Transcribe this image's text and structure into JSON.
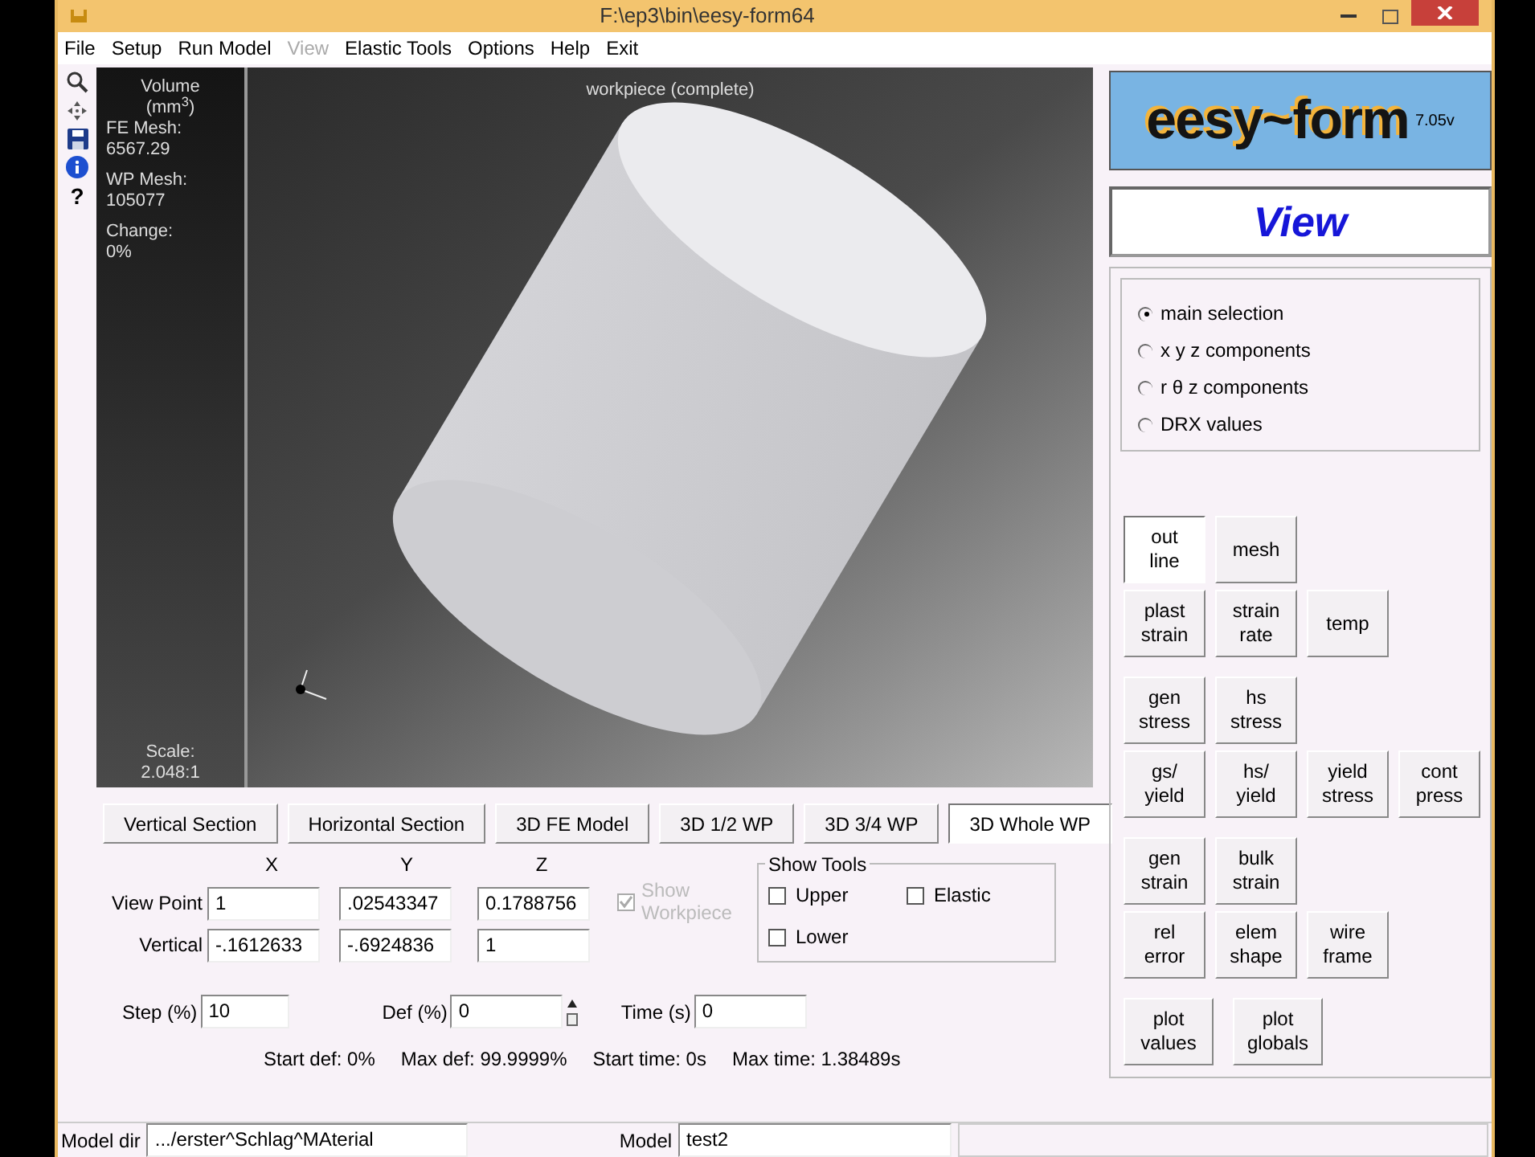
{
  "window": {
    "title": "F:\\ep3\\bin\\eesy-form64"
  },
  "menu": [
    {
      "label": "File",
      "disabled": false
    },
    {
      "label": "Setup",
      "disabled": false
    },
    {
      "label": "Run Model",
      "disabled": false
    },
    {
      "label": "View",
      "disabled": true
    },
    {
      "label": "Elastic Tools",
      "disabled": false
    },
    {
      "label": "Options",
      "disabled": false
    },
    {
      "label": "Help",
      "disabled": false
    },
    {
      "label": "Exit",
      "disabled": false
    }
  ],
  "toolbar": [
    {
      "kind": "zoom"
    },
    {
      "kind": "pan"
    },
    {
      "kind": "save"
    },
    {
      "kind": "info"
    },
    {
      "kind": "text",
      "label": "?"
    }
  ],
  "viewport": {
    "title": "workpiece (complete)",
    "info": [
      {
        "label": "Volume"
      },
      {
        "label": "(mm$^{3}$)"
      },
      {
        "label": "FE Mesh:"
      },
      {
        "label": "6567.29"
      },
      {
        "label": "WP Mesh:"
      },
      {
        "label": "105077"
      },
      {
        "label": "Change:"
      },
      {
        "label": "0%"
      }
    ],
    "scale_label": "Scale:",
    "scale": "2.048:1"
  },
  "view_buttons": [
    {
      "label": "Vertical Section",
      "selected": false
    },
    {
      "label": "Horizontal Section",
      "selected": false
    },
    {
      "label": "3D FE Model",
      "selected": false
    },
    {
      "label": "3D 1/2 WP",
      "selected": false
    },
    {
      "label": "3D 3/4 WP",
      "selected": false
    },
    {
      "label": "3D Whole WP",
      "selected": true
    }
  ],
  "coords": {
    "columns": [
      "X",
      "Y",
      "Z"
    ],
    "rows": [
      {
        "label": "View Point",
        "values": [
          "1",
          ".02543347",
          "0.1788756"
        ]
      },
      {
        "label": "Vertical",
        "values": [
          "-.1612633",
          "-.6924836",
          "1"
        ]
      }
    ]
  },
  "show_workpiece": {
    "label": "Show Workpiece",
    "checked": true,
    "disabled": true
  },
  "show_tools": {
    "title": "Show Tools",
    "items": [
      {
        "label": "Upper",
        "checked": false
      },
      {
        "label": "Elastic",
        "checked": false
      },
      {
        "label": "Lower",
        "checked": false
      }
    ]
  },
  "step": {
    "label": "Step (%)",
    "value": "10"
  },
  "def": {
    "label": "Def (%)",
    "value": "0"
  },
  "time": {
    "label": "Time (s)",
    "value": "0"
  },
  "info_line": [
    "Start def: 0%",
    "Max def: 99.9999%",
    "Start time: 0s",
    "Max time: 1.38489s"
  ],
  "logo": {
    "name": "eesy~form",
    "version": "7.05v"
  },
  "mode_title": "View",
  "radios": [
    {
      "label": "main selection",
      "selected": true
    },
    {
      "label": "x y z components",
      "selected": false
    },
    {
      "label": "r θ z components",
      "selected": false
    },
    {
      "label": "DRX values",
      "selected": false
    }
  ],
  "result_groups": [
    [
      [
        {
          "label": "out\nline",
          "selected": true
        },
        {
          "label": "mesh",
          "selected": false
        }
      ],
      [
        {
          "label": "plast\nstrain",
          "selected": false
        },
        {
          "label": "strain\nrate",
          "selected": false
        },
        {
          "label": "temp",
          "selected": false
        }
      ]
    ],
    [
      [
        {
          "label": "gen\nstress",
          "selected": false
        },
        {
          "label": "hs\nstress",
          "selected": false
        }
      ],
      [
        {
          "label": "gs/\nyield",
          "selected": false
        },
        {
          "label": "hs/\nyield",
          "selected": false
        },
        {
          "label": "yield\nstress",
          "selected": false
        },
        {
          "label": "cont\npress",
          "selected": false
        }
      ]
    ],
    [
      [
        {
          "label": "gen\nstrain",
          "selected": false
        },
        {
          "label": "bulk\nstrain",
          "selected": false
        }
      ],
      [
        {
          "label": "rel\nerror",
          "selected": false
        },
        {
          "label": "elem\nshape",
          "selected": false
        },
        {
          "label": "wire\nframe",
          "selected": false
        }
      ]
    ],
    [
      [
        {
          "label": "plot\nvalues",
          "selected": false
        },
        {
          "label": "plot\nglobals",
          "selected": false
        }
      ]
    ]
  ],
  "status_bar": {
    "model_dir_label": "Model dir",
    "model_dir": ".../erster^Schlag^MAterial",
    "model_label": "Model",
    "model": "test2"
  }
}
